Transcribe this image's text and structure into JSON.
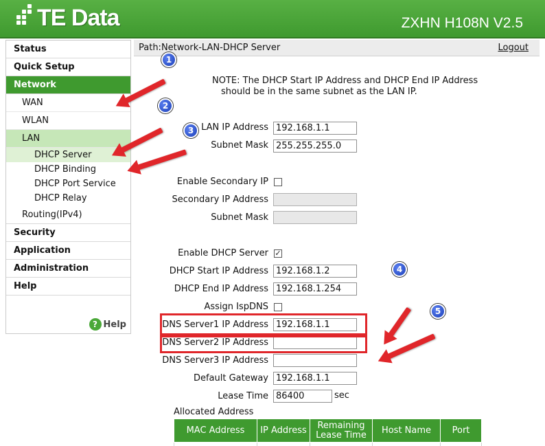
{
  "header": {
    "logo_dots_icon": "te-data-dots-icon",
    "logo_text": "TE Data",
    "model": "ZXHN H108N V2.5",
    "colors": {
      "brand": "#3f9a2f",
      "annotation_red": "#e0262a",
      "badge_blue": "#1b3fb8"
    }
  },
  "sidebar": {
    "items": [
      {
        "label": "Status"
      },
      {
        "label": "Quick Setup"
      },
      {
        "label": "Network"
      },
      {
        "label": "WAN"
      },
      {
        "label": "WLAN"
      },
      {
        "label": "LAN"
      },
      {
        "label": "DHCP Server"
      },
      {
        "label": "DHCP Binding"
      },
      {
        "label": "DHCP Port Service"
      },
      {
        "label": "DHCP Relay"
      },
      {
        "label": "Routing(IPv4)"
      },
      {
        "label": "Security"
      },
      {
        "label": "Application"
      },
      {
        "label": "Administration"
      },
      {
        "label": "Help"
      }
    ],
    "help_icon_glyph": "?",
    "help_label": "Help"
  },
  "path": {
    "text": "Path:Network-LAN-DHCP Server",
    "logout": "Logout"
  },
  "note": {
    "line1": "NOTE: The DHCP Start IP Address and DHCP End IP Address",
    "line2": "should be in the same subnet as the LAN IP."
  },
  "form": {
    "lan_ip": {
      "label": "LAN IP Address",
      "value": "192.168.1.1"
    },
    "subnet": {
      "label": "Subnet Mask",
      "value": "255.255.255.0"
    },
    "enable_secondary": {
      "label": "Enable Secondary IP",
      "checked": false
    },
    "secondary_ip": {
      "label": "Secondary IP Address",
      "value": ""
    },
    "secondary_subnet": {
      "label": "Subnet Mask",
      "value": ""
    },
    "enable_dhcp": {
      "label": "Enable DHCP Server",
      "checked": true,
      "check_glyph": "✓"
    },
    "dhcp_start": {
      "label": "DHCP Start IP Address",
      "value": "192.168.1.2"
    },
    "dhcp_end": {
      "label": "DHCP End IP Address",
      "value": "192.168.1.254"
    },
    "assign_ispdns": {
      "label": "Assign IspDNS",
      "checked": false
    },
    "dns1": {
      "label": "DNS Server1 IP Address",
      "value": "192.168.1.1"
    },
    "dns2": {
      "label": "DNS Server2 IP Address",
      "value": ""
    },
    "dns3": {
      "label": "DNS Server3 IP Address",
      "value": ""
    },
    "gateway": {
      "label": "Default Gateway",
      "value": "192.168.1.1"
    },
    "lease": {
      "label": "Lease Time",
      "value": "86400",
      "unit": "sec"
    }
  },
  "allocated": {
    "title": "Allocated Address",
    "columns": [
      "MAC Address",
      "IP Address",
      "Remaining Lease Time",
      "Host Name",
      "Port"
    ]
  },
  "annotations": {
    "badges": [
      "1",
      "2",
      "3",
      "4",
      "5"
    ]
  }
}
